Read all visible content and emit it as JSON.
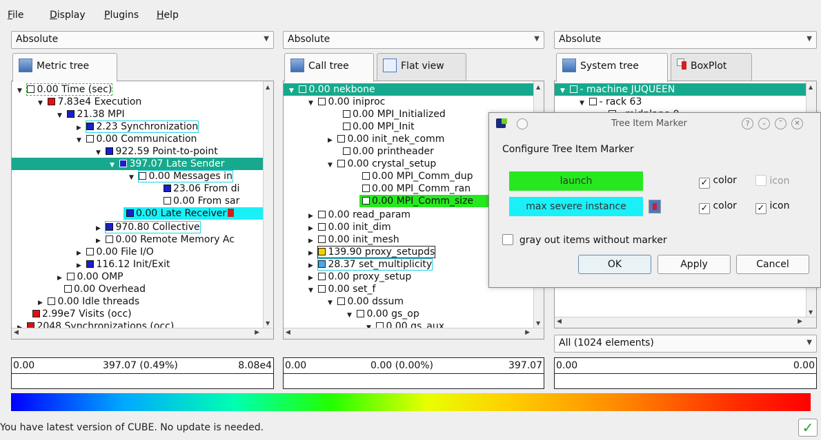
{
  "menu": [
    "File",
    "Display",
    "Plugins",
    "Help"
  ],
  "combos": {
    "metric": "Absolute",
    "call": "Absolute",
    "system": "Absolute"
  },
  "tabs": {
    "metric": [
      "Metric tree"
    ],
    "call": [
      "Call tree",
      "Flat view"
    ],
    "system": [
      "System tree",
      "BoxPlot"
    ]
  },
  "metric_tree": [
    "0.00 Time (sec)",
    "7.83e4 Execution",
    "21.38 MPI",
    "2.23 Synchronization",
    "0.00 Communication",
    "922.59 Point-to-point",
    "397.07 Late Sender",
    "0.00 Messages in",
    "23.06 From di",
    "0.00 From sar",
    "0.00 Late Receiver",
    "970.80 Collective",
    "0.00 Remote Memory Ac",
    "0.00 File I/O",
    "116.12 Init/Exit",
    "0.00 OMP",
    "0.00 Overhead",
    "0.00 Idle threads",
    "2.99e7 Visits (occ)",
    "2048 Synchronizations (occ)"
  ],
  "call_tree": [
    "0.00 nekbone",
    "0.00 iniproc",
    "0.00 MPI_Initialized",
    "0.00 MPI_Init",
    "0.00 init_nek_comm",
    "0.00 printheader",
    "0.00 crystal_setup",
    "0.00 MPI_Comm_dup",
    "0.00 MPI_Comm_ran",
    "0.00 MPI_Comm_size",
    "0.00 read_param",
    "0.00 init_dim",
    "0.00 init_mesh",
    "139.90 proxy_setupds",
    "28.37 set_multiplicity",
    "0.00 proxy_setup",
    "0.00 set_f",
    "0.00 dssum",
    "0.00 gs_op",
    "0.00 gs_aux"
  ],
  "system_tree": [
    "- machine JUQUEEN",
    "- rack 63",
    "- midplane 0"
  ],
  "system_filter": "All (1024 elements)",
  "value_bars": {
    "metric": {
      "min": "0.00",
      "mid": "397.07 (0.49%)",
      "max": "8.08e4"
    },
    "call": {
      "min": "0.00",
      "mid": "0.00 (0.00%)",
      "max": "397.07"
    },
    "system": {
      "min": "0.00",
      "max": "0.00"
    }
  },
  "status_text": "You have latest version of CUBE. No update is needed.",
  "dialog": {
    "title": "Tree Item Marker",
    "heading": "Configure Tree Item Marker",
    "marker1": "launch",
    "marker2": "max severe instance",
    "color_label": "color",
    "icon_label": "icon",
    "grayout_label": "gray out items without marker",
    "ok": "OK",
    "apply": "Apply",
    "cancel": "Cancel",
    "marker1_color": "#27e81f",
    "marker2_color": "#19f0f8"
  }
}
